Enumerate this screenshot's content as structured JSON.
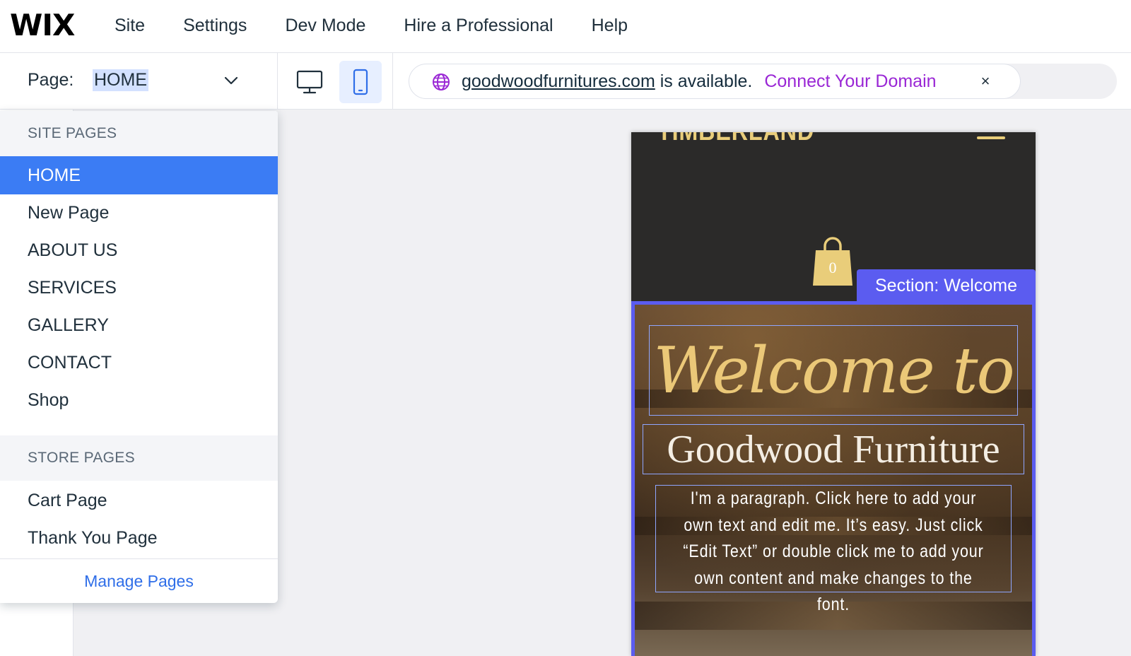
{
  "topbar": {
    "logo": "WIX",
    "menu": [
      "Site",
      "Settings",
      "Dev Mode",
      "Hire a Professional",
      "Help"
    ]
  },
  "page_selector": {
    "prefix": "Page:",
    "current": "HOME"
  },
  "device_switch": {
    "options": [
      "desktop",
      "mobile"
    ],
    "selected": "mobile"
  },
  "domain_banner": {
    "domain": "goodwoodfurnitures.com",
    "status": "is available.",
    "cta": "Connect Your Domain",
    "close": "×"
  },
  "pages_dropdown": {
    "site_pages_header": "SITE PAGES",
    "site_pages": [
      "HOME",
      "New Page",
      "ABOUT US",
      "SERVICES",
      "GALLERY",
      "CONTACT",
      "Shop"
    ],
    "selected": "HOME",
    "store_pages_header": "STORE PAGES",
    "store_pages": [
      "Cart Page",
      "Thank You Page"
    ],
    "manage": "Manage Pages"
  },
  "canvas": {
    "site_logo": "TIMBERLAND",
    "cart_count": "0",
    "section_label": "Section: Welcome",
    "welcome": "Welcome to",
    "brand": "Goodwood Furniture",
    "paragraph": "I'm a paragraph. Click here to add your own text and edit me. It’s easy. Just click “Edit Text” or double click me to add your own content and make changes to the font."
  },
  "colors": {
    "accent_blue": "#3b7cf4",
    "section_purple": "#5b5cf0",
    "connect_purple": "#9a27d5",
    "site_gold": "#e9cd7a",
    "site_dark": "#2b2a29"
  }
}
